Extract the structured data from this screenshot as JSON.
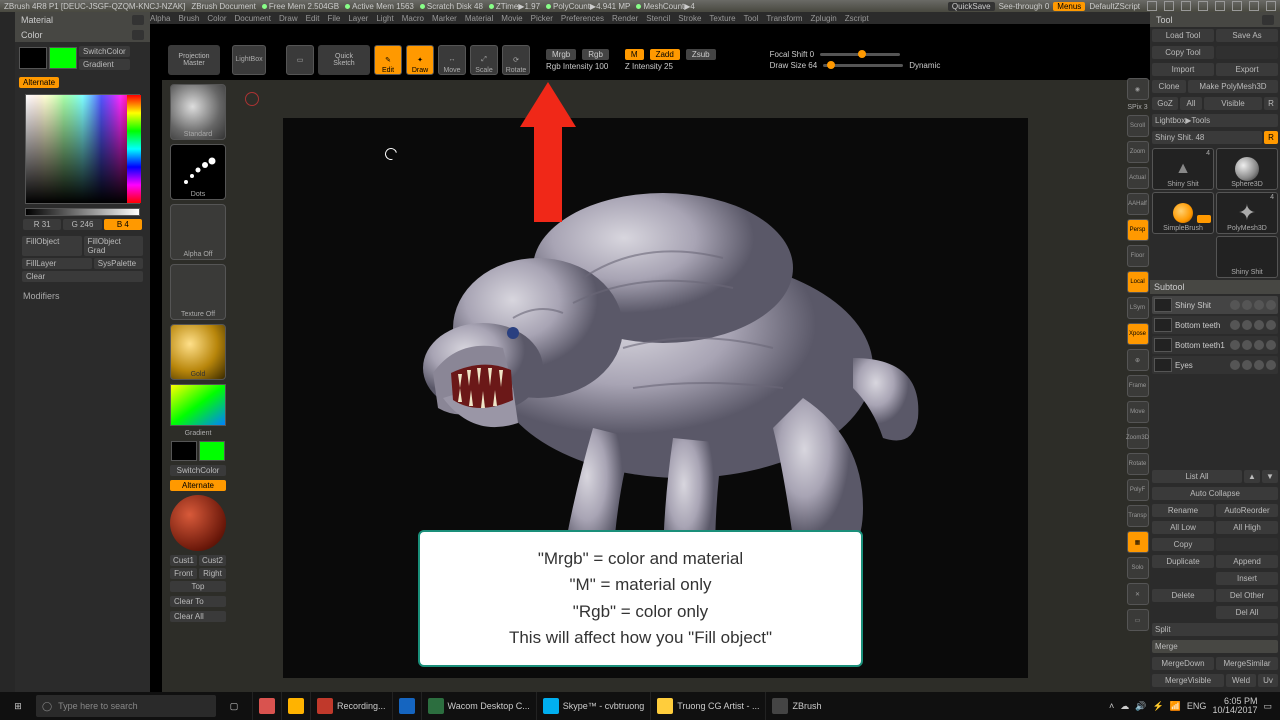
{
  "titlebar": {
    "app": "ZBrush 4R8 P1 [DEUC-JSGF-QZQM-KNCJ-NZAK]",
    "doc": "ZBrush Document",
    "mem": "Free Mem 2.504GB",
    "active": "Active Mem 1563",
    "scratch": "Scratch Disk 48",
    "ztime": "ZTime▶1.97",
    "polycount": "PolyCount▶4.941 MP",
    "meshcount": "MeshCount▶4",
    "quicksave": "QuickSave",
    "seethrough": "See-through  0",
    "menus": "Menus",
    "script": "DefaultZScript"
  },
  "menubar": [
    "Alpha",
    "Brush",
    "Color",
    "Document",
    "Draw",
    "Edit",
    "File",
    "Layer",
    "Light",
    "Macro",
    "Marker",
    "Material",
    "Movie",
    "Picker",
    "Preferences",
    "Render",
    "Stencil",
    "Stroke",
    "Texture",
    "Tool",
    "Transform",
    "Zplugin",
    "Zscript"
  ],
  "leftHeader": {
    "material": "Material",
    "color": "Color"
  },
  "colorPanel": {
    "switch": "SwitchColor",
    "gradient": "Gradient",
    "alternate": "Alternate",
    "r": "R 31",
    "g": "G 246",
    "b": "B 4",
    "fillObject": "FillObject",
    "fillObjectGrad": "FillObject Grad",
    "fillLayer": "FillLayer",
    "sysPalette": "SysPalette",
    "clear": "Clear",
    "modifiers": "Modifiers"
  },
  "brushCol": {
    "standard": "Standard",
    "dots": "Dots",
    "alphaOff": "Alpha Off",
    "textureOff": "Texture Off",
    "gold": "Gold",
    "gradient": "Gradient",
    "switch": "SwitchColor",
    "alternate": "Alternate",
    "cust1": "Cust1",
    "cust2": "Cust2",
    "front": "Front",
    "right": "Right",
    "top": "Top",
    "clearTo": "Clear To",
    "clearAll": "Clear All"
  },
  "topTools": {
    "projMaster1": "Projection",
    "projMaster2": "Master",
    "lightBox": "LightBox",
    "quickSketch1": "Quick",
    "quickSketch2": "Sketch",
    "edit": "Edit",
    "draw": "Draw",
    "move": "Move",
    "scale": "Scale",
    "rotate": "Rotate",
    "mrgb": "Mrgb",
    "rgb": "Rgb",
    "rgbIntensity": "Rgb Intensity 100",
    "m": "M",
    "zadd": "Zadd",
    "zsub": "Zsub",
    "zIntensity": "Z Intensity 25",
    "focal": "Focal Shift 0",
    "drawSize": "Draw Size 64",
    "dynamic": "Dynamic"
  },
  "rightPanel": {
    "tool": "Tool",
    "row1": [
      "Load Tool",
      "Save As"
    ],
    "row2": [
      "Copy Tool",
      ""
    ],
    "row3": [
      "Import",
      "Export"
    ],
    "row4": [
      "Clone",
      "Make PolyMesh3D"
    ],
    "row5": [
      "GoZ",
      "All",
      "Visible",
      "R"
    ],
    "lightbox": "Lightbox▶Tools",
    "shiny": "Shiny Shit. 48",
    "thumbs": {
      "shinyShit": "Shiny Shit",
      "sphere3d": "Sphere3D",
      "polymesh": "PolyMesh3D",
      "simplebrush": "SimpleBrush",
      "shinyShit2": "Shiny Shit"
    },
    "subtool": "Subtool",
    "items": [
      {
        "n": "Shiny Shit"
      },
      {
        "n": "Bottom teeth"
      },
      {
        "n": "Bottom teeth1"
      },
      {
        "n": "Eyes"
      }
    ],
    "listAll": "List All",
    "autoCollapse": "Auto Collapse",
    "rename": "Rename",
    "autoReorder": "AutoReorder",
    "allLow": "All Low",
    "allHigh": "All High",
    "copy": "Copy",
    "paste": "",
    "duplicate": "Duplicate",
    "append": "Append",
    "insert": "Insert",
    "delete": "Delete",
    "delOther": "Del Other",
    "delAll": "Del All",
    "split": "Split",
    "merge": "Merge",
    "mergeDown": "MergeDown",
    "mergeSimilar": "MergeSimilar",
    "mergeVisible": "MergeVisible",
    "weld": "Weld",
    "uv": "Uv"
  },
  "rightIcons": [
    "SPix 3",
    "Scroll",
    "Zoom",
    "Actual",
    "AAHalf",
    "Persp",
    "   ",
    "Floor",
    "Local",
    "LSym",
    "Xpose",
    "   ",
    "Frame",
    "Move",
    "Zoom3D",
    "Rotate",
    "PolyF",
    "Transp",
    "   ",
    "Solo",
    "   "
  ],
  "tooltip": {
    "l1": "\"Mrgb\" = color and material",
    "l2": "\"M\" = material only",
    "l3": "\"Rgb\" = color only",
    "l4": "This will affect how you \"Fill object\""
  },
  "taskbar": {
    "search": "Type here to search",
    "items": [
      "Recording...",
      "",
      "Wacom Desktop C...",
      "Skype™ - cvbtruong",
      "Truong CG Artist - ...",
      "ZBrush"
    ],
    "time": "6:05 PM",
    "date": "10/14/2017",
    "lang": "ENG"
  }
}
